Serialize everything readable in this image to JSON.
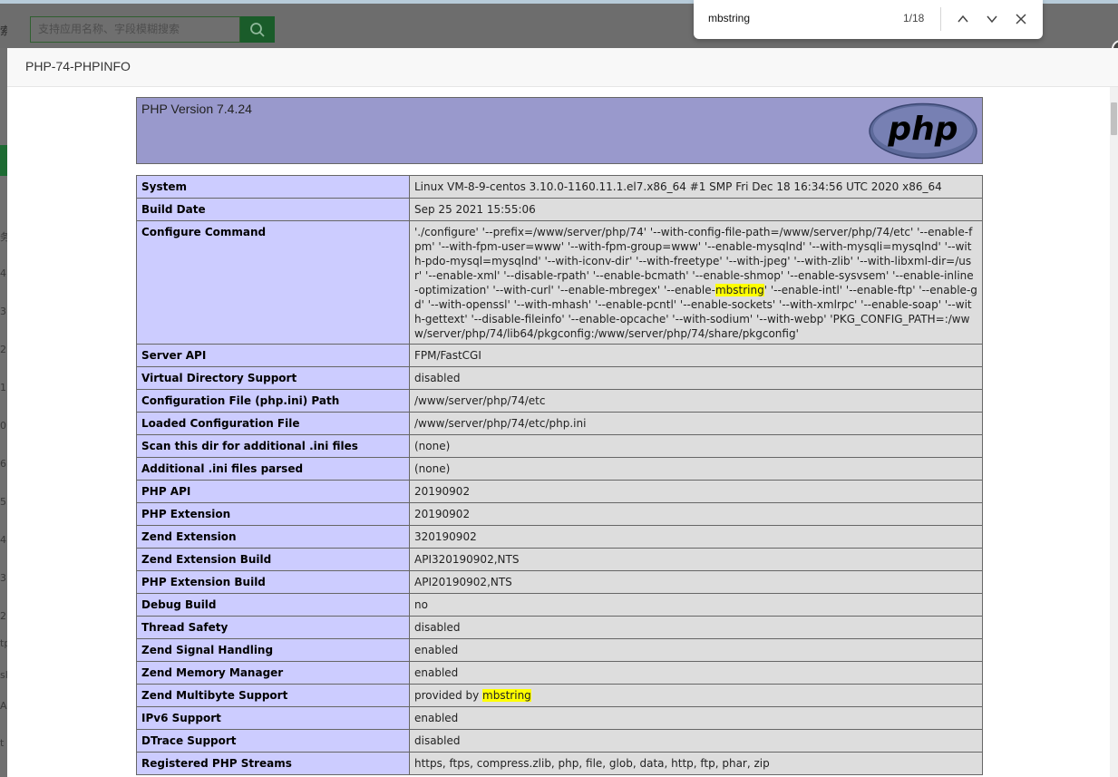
{
  "background": {
    "search_placeholder": "支持应用名称、字段模糊搜索",
    "edge_chars": [
      "索",
      "类"
    ],
    "left_fragments": [
      "务",
      "4",
      "3",
      "2",
      "1",
      "0",
      "6",
      "5",
      "4",
      "3",
      "2",
      "tp",
      "sl",
      "A",
      "t"
    ]
  },
  "find_bar": {
    "query": "mbstring",
    "count": "1/18"
  },
  "dialog": {
    "title": "PHP-74-PHPINFO"
  },
  "phpinfo": {
    "version": "PHP Version 7.4.24",
    "logo_text": "php",
    "rows": [
      {
        "label": "System",
        "value": "Linux VM-8-9-centos 3.10.0-1160.11.1.el7.x86_64 #1 SMP Fri Dec 18 16:34:56 UTC 2020 x86_64"
      },
      {
        "label": "Build Date",
        "value": "Sep 25 2021 15:55:06"
      },
      {
        "label": "Configure Command",
        "value_before": "'./configure' '--prefix=/www/server/php/74' '--with-config-file-path=/www/server/php/74/etc' '--enable-fpm' '--with-fpm-user=www' '--with-fpm-group=www' '--enable-mysqlnd' '--with-mysqli=mysqlnd' '--with-pdo-mysql=mysqlnd' '--with-iconv-dir' '--with-freetype' '--with-jpeg' '--with-zlib' '--with-libxml-dir=/usr' '--enable-xml' '--disable-rpath' '--enable-bcmath' '--enable-shmop' '--enable-sysvsem' '--enable-inline-optimization' '--with-curl' '--enable-mbregex' '--enable-",
        "value_highlight": "mbstring",
        "value_after": "' '--enable-intl' '--enable-ftp' '--enable-gd' '--with-openssl' '--with-mhash' '--enable-pcntl' '--enable-sockets' '--with-xmlrpc' '--enable-soap' '--with-gettext' '--disable-fileinfo' '--enable-opcache' '--with-sodium' '--with-webp' 'PKG_CONFIG_PATH=:/www/server/php/74/lib64/pkgconfig:/www/server/php/74/share/pkgconfig'"
      },
      {
        "label": "Server API",
        "value": "FPM/FastCGI"
      },
      {
        "label": "Virtual Directory Support",
        "value": "disabled"
      },
      {
        "label": "Configuration File (php.ini) Path",
        "value": "/www/server/php/74/etc"
      },
      {
        "label": "Loaded Configuration File",
        "value": "/www/server/php/74/etc/php.ini"
      },
      {
        "label": "Scan this dir for additional .ini files",
        "value": "(none)"
      },
      {
        "label": "Additional .ini files parsed",
        "value": "(none)"
      },
      {
        "label": "PHP API",
        "value": "20190902"
      },
      {
        "label": "PHP Extension",
        "value": "20190902"
      },
      {
        "label": "Zend Extension",
        "value": "320190902"
      },
      {
        "label": "Zend Extension Build",
        "value": "API320190902,NTS"
      },
      {
        "label": "PHP Extension Build",
        "value": "API20190902,NTS"
      },
      {
        "label": "Debug Build",
        "value": "no"
      },
      {
        "label": "Thread Safety",
        "value": "disabled"
      },
      {
        "label": "Zend Signal Handling",
        "value": "enabled"
      },
      {
        "label": "Zend Memory Manager",
        "value": "enabled"
      },
      {
        "label": "Zend Multibyte Support",
        "value_before": "provided by ",
        "value_highlight": "mbstring",
        "value_after": ""
      },
      {
        "label": "IPv6 Support",
        "value": "enabled"
      },
      {
        "label": "DTrace Support",
        "value": "disabled"
      },
      {
        "label": "Registered PHP Streams",
        "value": "https, ftps, compress.zlib, php, file, glob, data, http, ftp, phar, zip"
      }
    ]
  },
  "colors": {
    "header_bg": "#9999cc",
    "label_bg": "#ccccff",
    "value_bg": "#dddddd",
    "highlight": "#ffff00",
    "accent_green": "#1a5c2a"
  }
}
